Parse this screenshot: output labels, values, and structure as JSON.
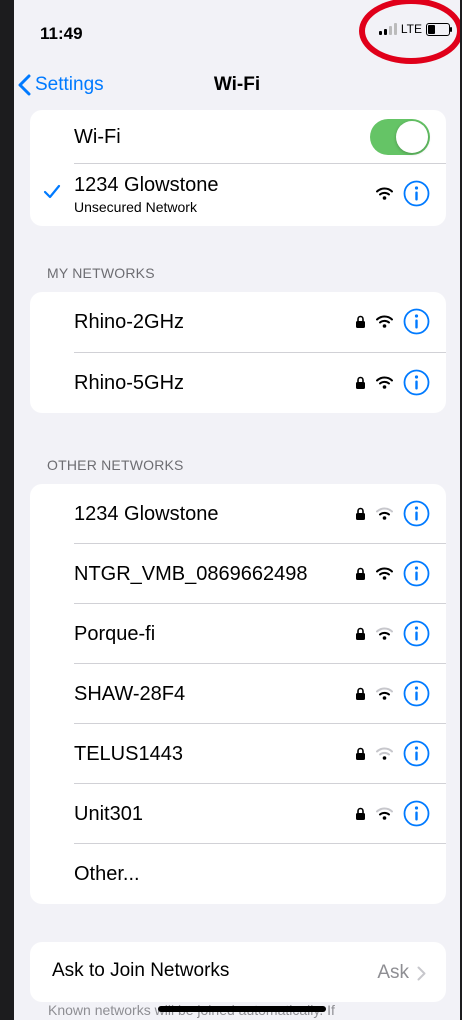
{
  "status_bar": {
    "time": "11:49",
    "network": "LTE",
    "battery_level": 0.35
  },
  "nav": {
    "back_label": "Settings",
    "title": "Wi-Fi"
  },
  "wifi": {
    "label": "Wi-Fi",
    "enabled": true,
    "accent": "#65c466"
  },
  "connected": {
    "name": "1234 Glowstone",
    "status": "Unsecured Network"
  },
  "my_networks": {
    "header": "MY NETWORKS",
    "items": [
      {
        "name": "Rhino-2GHz",
        "locked": true
      },
      {
        "name": "Rhino-5GHz",
        "locked": true
      }
    ]
  },
  "other_networks": {
    "header": "OTHER NETWORKS",
    "items": [
      {
        "name": "1234 Glowstone",
        "locked": true
      },
      {
        "name": "NTGR_VMB_0869662498",
        "locked": true
      },
      {
        "name": "Porque-fi",
        "locked": true
      },
      {
        "name": "SHAW-28F4",
        "locked": true
      },
      {
        "name": "TELUS1443",
        "locked": true
      },
      {
        "name": "Unit301",
        "locked": true
      }
    ],
    "other_label": "Other..."
  },
  "ask_to_join": {
    "label": "Ask to Join Networks",
    "value": "Ask"
  },
  "footer_text": "Known networks will be joined automatically. If",
  "colors": {
    "accent_blue": "#007aff",
    "annotation_red": "#e0001a"
  }
}
